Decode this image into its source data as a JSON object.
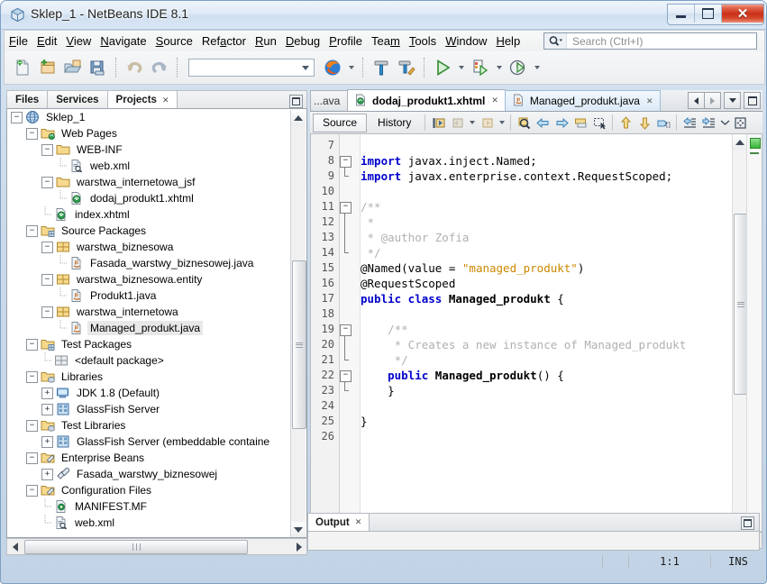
{
  "window": {
    "title": "Sklep_1 - NetBeans IDE 8.1",
    "app_icon": "netbeans-cube-icon",
    "buttons": {
      "minimize": "minimize",
      "maximize": "maximize",
      "close": "✕"
    }
  },
  "menubar": {
    "items": [
      {
        "label": "File",
        "mnemonic": "F"
      },
      {
        "label": "Edit",
        "mnemonic": "E"
      },
      {
        "label": "View",
        "mnemonic": "V"
      },
      {
        "label": "Navigate",
        "mnemonic": "N"
      },
      {
        "label": "Source",
        "mnemonic": "S"
      },
      {
        "label": "Refactor",
        "mnemonic": "R"
      },
      {
        "label": "Run",
        "mnemonic": "R"
      },
      {
        "label": "Debug",
        "mnemonic": "D"
      },
      {
        "label": "Profile",
        "mnemonic": "P"
      },
      {
        "label": "Team",
        "mnemonic": "m"
      },
      {
        "label": "Tools",
        "mnemonic": "T"
      },
      {
        "label": "Window",
        "mnemonic": "W"
      },
      {
        "label": "Help",
        "mnemonic": "H"
      }
    ],
    "search": {
      "placeholder": "Search (Ctrl+I)",
      "value": "",
      "icon": "search-icon"
    }
  },
  "toolbar": {
    "buttons": [
      {
        "name": "new-file-button",
        "icon": "new-file-icon"
      },
      {
        "name": "new-project-button",
        "icon": "new-project-icon"
      },
      {
        "name": "open-project-button",
        "icon": "open-project-icon"
      },
      {
        "name": "save-all-button",
        "icon": "save-all-icon"
      },
      {
        "name": "undo-button",
        "icon": "undo-icon"
      },
      {
        "name": "redo-button",
        "icon": "redo-icon"
      }
    ],
    "config_combo": {
      "value": "",
      "icon": "chevron-down-icon"
    },
    "right_buttons": [
      {
        "name": "browser-button",
        "icon": "firefox-icon"
      },
      {
        "name": "build-project-button",
        "icon": "hammer-icon"
      },
      {
        "name": "clean-build-button",
        "icon": "clean-build-icon"
      },
      {
        "name": "run-project-button",
        "icon": "run-icon"
      },
      {
        "name": "debug-project-button",
        "icon": "debug-icon"
      },
      {
        "name": "profile-project-button",
        "icon": "profile-icon"
      }
    ]
  },
  "explorer": {
    "tabs": [
      {
        "label": "Files",
        "active": false
      },
      {
        "label": "Services",
        "active": false
      },
      {
        "label": "Projects",
        "active": true,
        "close": "✕"
      }
    ],
    "minimize_icon": "minimize-panel-icon",
    "tree": [
      {
        "label": "Sklep_1",
        "depth": 0,
        "toggle": "minus",
        "icon": "project-globe-icon",
        "selected": false
      },
      {
        "label": "Web Pages",
        "depth": 1,
        "toggle": "minus",
        "icon": "folder-web-icon",
        "selected": false
      },
      {
        "label": "WEB-INF",
        "depth": 2,
        "toggle": "minus",
        "icon": "folder-icon",
        "selected": false
      },
      {
        "label": "web.xml",
        "depth": 3,
        "toggle": "none",
        "icon": "xml-file-icon",
        "selected": false
      },
      {
        "label": "warstwa_internetowa_jsf",
        "depth": 2,
        "toggle": "minus",
        "icon": "folder-icon",
        "selected": false
      },
      {
        "label": "dodaj_produkt1.xhtml",
        "depth": 3,
        "toggle": "none",
        "icon": "xhtml-file-icon",
        "selected": false
      },
      {
        "label": "index.xhtml",
        "depth": 2,
        "toggle": "none",
        "icon": "xhtml-file-icon",
        "selected": false
      },
      {
        "label": "Source Packages",
        "depth": 1,
        "toggle": "minus",
        "icon": "source-packages-icon",
        "selected": false
      },
      {
        "label": "warstwa_biznesowa",
        "depth": 2,
        "toggle": "minus",
        "icon": "package-icon",
        "selected": false
      },
      {
        "label": "Fasada_warstwy_biznesowej.java",
        "depth": 3,
        "toggle": "none",
        "icon": "java-file-icon",
        "selected": false
      },
      {
        "label": "warstwa_biznesowa.entity",
        "depth": 2,
        "toggle": "minus",
        "icon": "package-icon",
        "selected": false
      },
      {
        "label": "Produkt1.java",
        "depth": 3,
        "toggle": "none",
        "icon": "java-file-icon",
        "selected": false
      },
      {
        "label": "warstwa_internetowa",
        "depth": 2,
        "toggle": "minus",
        "icon": "package-icon",
        "selected": false
      },
      {
        "label": "Managed_produkt.java",
        "depth": 3,
        "toggle": "none",
        "icon": "java-file-icon",
        "selected": true
      },
      {
        "label": "Test Packages",
        "depth": 1,
        "toggle": "minus",
        "icon": "source-packages-icon",
        "selected": false
      },
      {
        "label": "<default package>",
        "depth": 2,
        "toggle": "none",
        "icon": "package-gray-icon",
        "selected": false
      },
      {
        "label": "Libraries",
        "depth": 1,
        "toggle": "minus",
        "icon": "libraries-icon",
        "selected": false
      },
      {
        "label": "JDK 1.8 (Default)",
        "depth": 2,
        "toggle": "plus",
        "icon": "jdk-icon",
        "selected": false
      },
      {
        "label": "GlassFish Server",
        "depth": 2,
        "toggle": "plus",
        "icon": "server-lib-icon",
        "selected": false
      },
      {
        "label": "Test Libraries",
        "depth": 1,
        "toggle": "minus",
        "icon": "libraries-icon",
        "selected": false
      },
      {
        "label": "GlassFish Server (embeddable containe",
        "depth": 2,
        "toggle": "plus",
        "icon": "server-lib-icon",
        "selected": false
      },
      {
        "label": "Enterprise Beans",
        "depth": 1,
        "toggle": "minus",
        "icon": "ejb-folder-icon",
        "selected": false
      },
      {
        "label": "Fasada_warstwy_biznesowej",
        "depth": 2,
        "toggle": "plus",
        "icon": "ejb-bean-icon",
        "selected": false
      },
      {
        "label": "Configuration Files",
        "depth": 1,
        "toggle": "minus",
        "icon": "config-folder-icon",
        "selected": false
      },
      {
        "label": "MANIFEST.MF",
        "depth": 2,
        "toggle": "none",
        "icon": "manifest-icon",
        "selected": false
      },
      {
        "label": "web.xml",
        "depth": 2,
        "toggle": "none",
        "icon": "xml-file-icon",
        "selected": false
      }
    ]
  },
  "editor": {
    "tabs": [
      {
        "label": "...ava",
        "active": false,
        "partial": true,
        "icon": "java-file-icon"
      },
      {
        "label": "dodaj_produkt1.xhtml",
        "active": true,
        "bold": true,
        "close": "✕",
        "icon": "xhtml-file-icon"
      },
      {
        "label": "Managed_produkt.java",
        "active": false,
        "selected": true,
        "close": "✕",
        "icon": "java-file-icon"
      }
    ],
    "tab_nav": [
      {
        "name": "scroll-tabs-left-button",
        "icon": "chevron-left-icon"
      },
      {
        "name": "scroll-tabs-right-button",
        "icon": "chevron-right-icon"
      },
      {
        "name": "tab-list-button",
        "icon": "chevron-down-icon"
      },
      {
        "name": "maximize-editor-button",
        "icon": "maximize-panel-icon"
      }
    ],
    "view_tabs": [
      {
        "label": "Source",
        "active": true
      },
      {
        "label": "History",
        "active": false
      }
    ],
    "toolbar_icons": [
      "last-edit-icon",
      "back-icon",
      "forward-icon",
      "find-selection-icon",
      "previous-bookmark-icon",
      "next-bookmark-icon",
      "toggle-bookmark-icon",
      "toggle-rectangular-selection-icon",
      "previous-error-icon",
      "next-error-icon",
      "shift-line-icon",
      "shift-line-left-icon",
      "shift-line-right-icon",
      "more-icon",
      "toggle-highlight-icon"
    ],
    "first_line": 7,
    "lines": [
      {
        "n": 7,
        "tokens": []
      },
      {
        "n": 8,
        "tokens": [
          {
            "t": "import ",
            "c": "kw"
          },
          {
            "t": "javax.inject.Named;",
            "c": "pl"
          }
        ]
      },
      {
        "n": 9,
        "tokens": [
          {
            "t": "import ",
            "c": "kw"
          },
          {
            "t": "javax.enterprise.context.RequestScoped;",
            "c": "pl"
          }
        ]
      },
      {
        "n": 10,
        "tokens": []
      },
      {
        "n": 11,
        "tokens": [
          {
            "t": "/**",
            "c": "cm"
          }
        ]
      },
      {
        "n": 12,
        "tokens": [
          {
            "t": " *",
            "c": "cm"
          }
        ]
      },
      {
        "n": 13,
        "tokens": [
          {
            "t": " * @author Zofia",
            "c": "cm"
          }
        ]
      },
      {
        "n": 14,
        "tokens": [
          {
            "t": " */",
            "c": "cm"
          }
        ]
      },
      {
        "n": 15,
        "tokens": [
          {
            "t": "@Named(value = ",
            "c": "pl"
          },
          {
            "t": "\"managed_produkt\"",
            "c": "st"
          },
          {
            "t": ")",
            "c": "pl"
          }
        ]
      },
      {
        "n": 16,
        "tokens": [
          {
            "t": "@RequestScoped",
            "c": "pl"
          }
        ]
      },
      {
        "n": 17,
        "tokens": [
          {
            "t": "public class ",
            "c": "kw"
          },
          {
            "t": "Managed_produkt",
            "c": "bd"
          },
          {
            "t": " {",
            "c": "pl"
          }
        ]
      },
      {
        "n": 18,
        "tokens": []
      },
      {
        "n": 19,
        "tokens": [
          {
            "t": "    /**",
            "c": "cm"
          }
        ]
      },
      {
        "n": 20,
        "tokens": [
          {
            "t": "     * Creates a new instance of Managed_produkt",
            "c": "cm"
          }
        ]
      },
      {
        "n": 21,
        "tokens": [
          {
            "t": "     */",
            "c": "cm"
          }
        ]
      },
      {
        "n": 22,
        "tokens": [
          {
            "t": "    public ",
            "c": "kw"
          },
          {
            "t": "Managed_produkt",
            "c": "bd"
          },
          {
            "t": "() {",
            "c": "pl"
          }
        ]
      },
      {
        "n": 23,
        "tokens": [
          {
            "t": "    }",
            "c": "pl"
          }
        ]
      },
      {
        "n": 24,
        "tokens": []
      },
      {
        "n": 25,
        "tokens": [
          {
            "t": "}",
            "c": "pl"
          }
        ]
      },
      {
        "n": 26,
        "tokens": []
      }
    ],
    "annotation": {
      "status": "ok",
      "color": "#39b339"
    }
  },
  "output": {
    "tab_label": "Output",
    "close": "✕",
    "minimize_icon": "minimize-panel-icon",
    "content": ""
  },
  "statusbar": {
    "cursor_position": "1:1",
    "insert_mode": "INS"
  },
  "colors": {
    "accent": "#3b6ea5",
    "keyword": "#0000cc",
    "string": "#cc8800",
    "comment": "#b0b0b0",
    "selection": "#e8e8e8",
    "titlebar_close": "#c9301a"
  }
}
